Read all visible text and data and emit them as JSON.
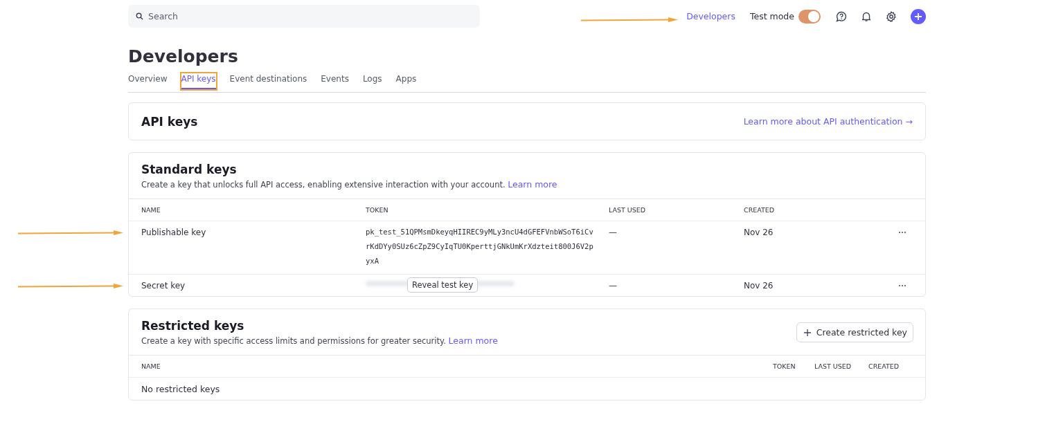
{
  "topbar": {
    "search": {
      "placeholder": "Search"
    },
    "developers_link": {
      "label": "Developers",
      "pointed": true
    },
    "test_mode": {
      "label": "Test mode",
      "on": true
    }
  },
  "page": {
    "title": "Developers"
  },
  "tabs": [
    {
      "label": "Overview",
      "selected": false,
      "highlighted": false
    },
    {
      "label": "API keys",
      "selected": true,
      "highlighted": true
    },
    {
      "label": "Event destinations",
      "selected": false,
      "highlighted": false
    },
    {
      "label": "Events",
      "selected": false,
      "highlighted": false
    },
    {
      "label": "Logs",
      "selected": false,
      "highlighted": false
    },
    {
      "label": "Apps",
      "selected": false,
      "highlighted": false
    }
  ],
  "api_keys_card": {
    "title": "API keys",
    "link": "Learn more about API authentication →"
  },
  "standard_keys": {
    "title": "Standard keys",
    "description": "Create a key that unlocks full API access, enabling extensive interaction with your account.",
    "learn_more": "Learn more",
    "columns": [
      "NAME",
      "TOKEN",
      "LAST USED",
      "CREATED"
    ],
    "rows": [
      {
        "name": "Publishable key",
        "token": "pk_test_51QPMsmDkeyqHIIREC9yMLy3ncU4dGFEFVnbWSoT6iCvrKdDYy0SUz6cZpZ9CyIqTU0KperttjGNkUmKrXdzteit800J6V2pyxA",
        "hidden": false,
        "reveal_button": "",
        "last_used": "—",
        "created": "Nov 26",
        "pointed": true
      },
      {
        "name": "Secret key",
        "token": "",
        "hidden": true,
        "reveal_button": "Reveal test key",
        "last_used": "—",
        "created": "Nov 26",
        "pointed": true
      }
    ]
  },
  "restricted_keys": {
    "title": "Restricted keys",
    "description": "Create a key with specific access limits and permissions for greater security.",
    "learn_more": "Learn more",
    "create_button": "Create restricted key",
    "columns": [
      "NAME",
      "TOKEN",
      "LAST USED",
      "CREATED"
    ],
    "empty_message": "No restricted keys"
  }
}
